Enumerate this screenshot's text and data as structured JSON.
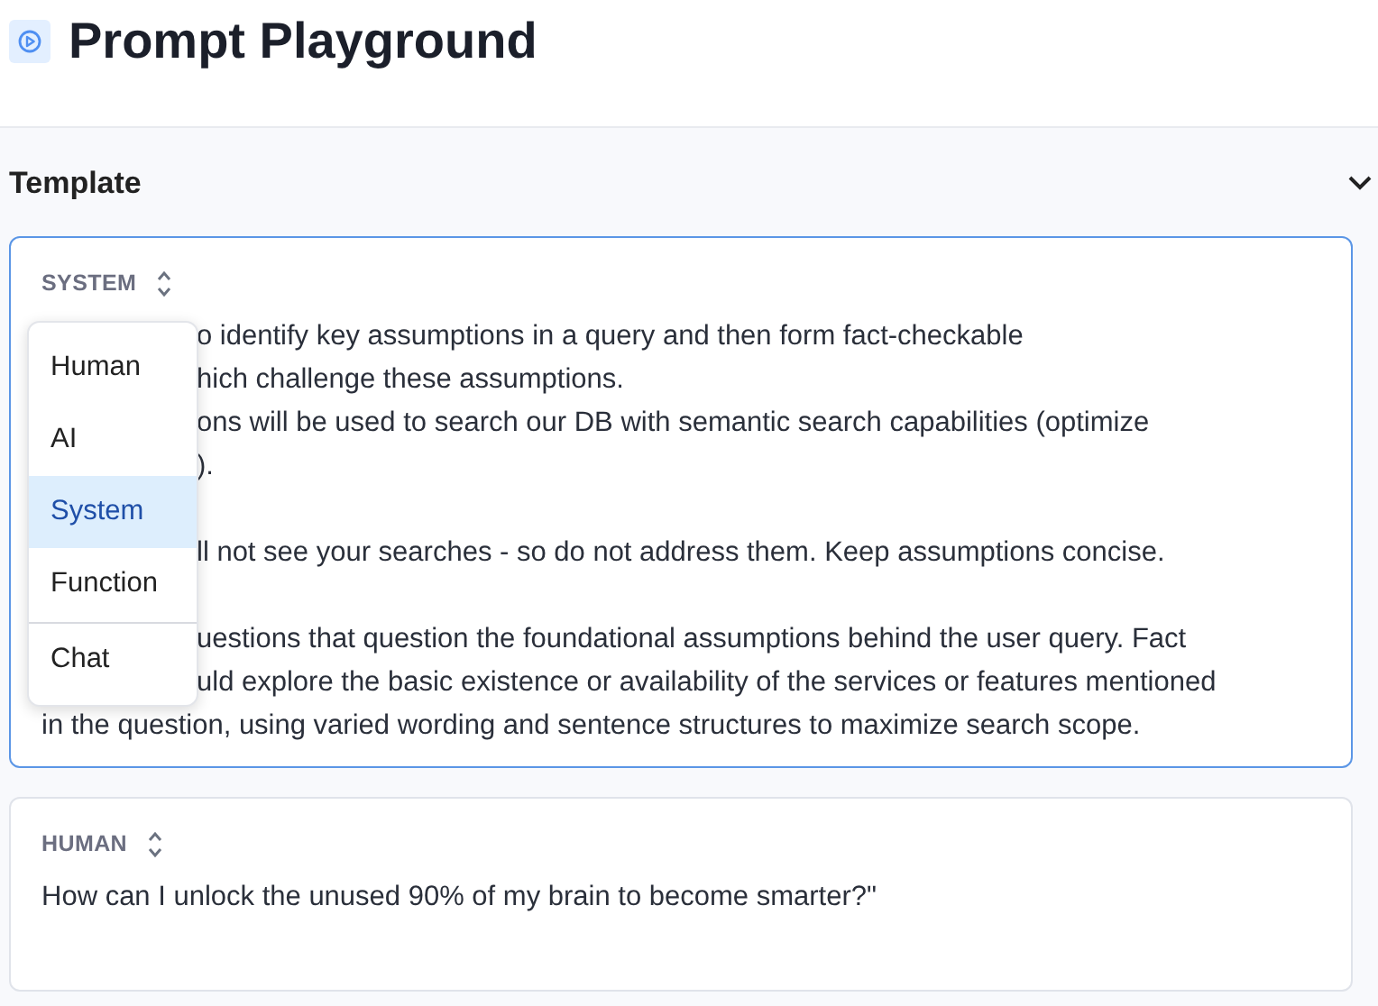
{
  "page": {
    "title": "Prompt Playground"
  },
  "section": {
    "title": "Template",
    "expanded": true
  },
  "messages": [
    {
      "role": "SYSTEM",
      "focused": true,
      "paragraphs": [
        [
          "o identify key assumptions in a query and then form fact-checkable",
          "hich challenge these assumptions.",
          "ons will be used to search our DB with semantic search capabilities (optimize",
          ")."
        ],
        [
          "ll not see your searches - so do not address them. Keep assumptions concise."
        ],
        [
          "uestions that question the foundational assumptions behind the user query. Fact",
          "uld explore the basic existence or availability of the services or features mentioned",
          "in the question, using varied wording and sentence structures to maximize search scope."
        ]
      ],
      "menu": [
        {
          "label": "Human",
          "selected": false,
          "divider_before": false
        },
        {
          "label": "AI",
          "selected": false,
          "divider_before": false
        },
        {
          "label": "System",
          "selected": true,
          "divider_before": false
        },
        {
          "label": "Function",
          "selected": false,
          "divider_before": false
        },
        {
          "label": "Chat",
          "selected": false,
          "divider_before": true
        }
      ]
    },
    {
      "role": "HUMAN",
      "focused": false,
      "paragraphs": [
        [
          "How can I unlock the unused 90% of my brain to become smarter?\""
        ]
      ]
    }
  ]
}
